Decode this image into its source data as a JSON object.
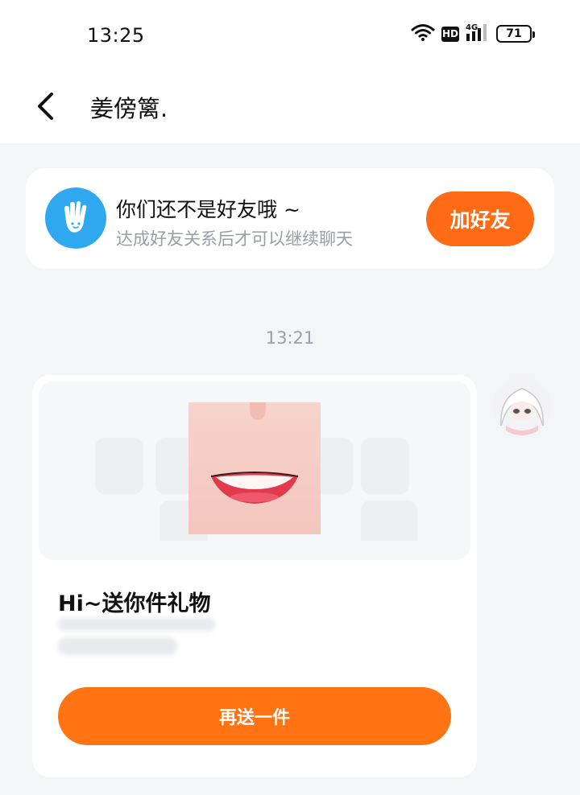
{
  "status_bar": {
    "time": "13:25",
    "network": "4G",
    "hd": "HD",
    "battery": "71"
  },
  "header": {
    "title": "姜傍篱."
  },
  "friend_notice": {
    "title": "你们还不是好友哦 ~",
    "subtitle": "达成好友关系后才可以继续聊天",
    "add_button": "加好友",
    "icon": "hand-icon"
  },
  "chat": {
    "timestamp": "13:21",
    "gift_message": {
      "title": "Hi~送你件礼物",
      "button": "再送一件"
    }
  },
  "colors": {
    "accent": "#ff6a14",
    "avatar_blue": "#2fa8f0",
    "background": "#f4f5f7"
  }
}
